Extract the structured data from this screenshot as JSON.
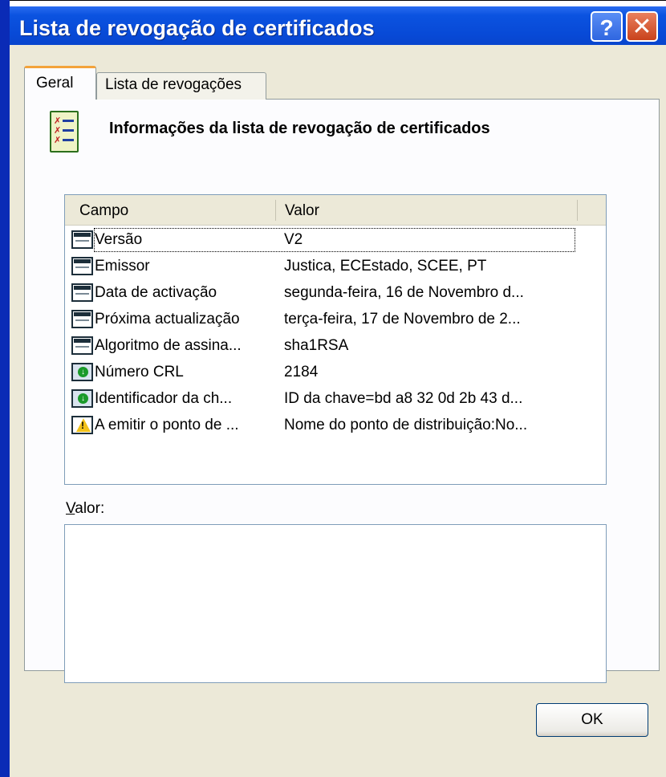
{
  "window": {
    "title": "Lista de revogação de certificados",
    "help_glyph": "?",
    "close_glyph": "✕"
  },
  "tabs": [
    {
      "label": "Geral",
      "active": true
    },
    {
      "label": "Lista de revogações",
      "active": false
    }
  ],
  "header": {
    "title": "Informações da lista de revogação de certificados",
    "icon": "crl-document-icon"
  },
  "list": {
    "columns": [
      "Campo",
      "Valor"
    ],
    "rows": [
      {
        "field": "Versão",
        "value": "V2",
        "icon": "field-icon"
      },
      {
        "field": "Emissor",
        "value": "Justica, ECEstado, SCEE, PT",
        "icon": "field-icon"
      },
      {
        "field": "Data de activação",
        "value": "segunda-feira, 16 de Novembro d...",
        "icon": "field-icon"
      },
      {
        "field": "Próxima actualização",
        "value": "terça-feira, 17 de Novembro de 2...",
        "icon": "field-icon"
      },
      {
        "field": "Algoritmo de assina...",
        "value": "sha1RSA",
        "icon": "field-icon"
      },
      {
        "field": "Número CRL",
        "value": "2184",
        "icon": "extension-icon"
      },
      {
        "field": "Identificador da ch...",
        "value": "ID da chave=bd a8 32 0d 2b 43 d...",
        "icon": "extension-icon"
      },
      {
        "field": "A emitir o ponto de ...",
        "value": "Nome do ponto de distribuição:No...",
        "icon": "critical-extension-icon"
      }
    ],
    "selected_index": 0
  },
  "valor": {
    "label_prefix": "V",
    "label_rest": "alor:",
    "content": ""
  },
  "buttons": {
    "ok": "OK"
  }
}
